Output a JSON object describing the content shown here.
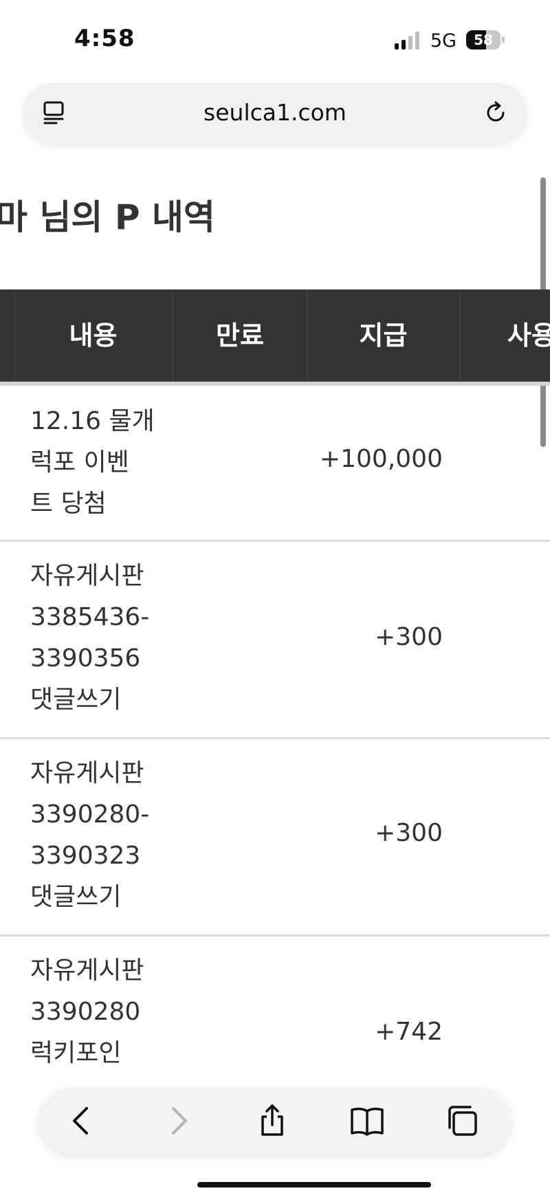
{
  "status_bar": {
    "time": "4:58",
    "network": "5G",
    "battery": "58",
    "battery_level": 0.58
  },
  "url_bar": {
    "url": "seulca1.com",
    "reader_icon": "reader-icon",
    "reload_icon": "reload-icon"
  },
  "page": {
    "title": "마 님의 P 내역"
  },
  "table": {
    "columns": [
      "내용",
      "만료",
      "지급",
      "사용"
    ],
    "rows": [
      {
        "content_lines": [
          "12.16 물개",
          "럭포 이벤",
          "트 당첨"
        ],
        "expiry": "",
        "paid": "+100,000",
        "used": ""
      },
      {
        "content_lines": [
          "자유게시판",
          "3385436-",
          "3390356",
          "댓글쓰기"
        ],
        "expiry": "",
        "paid": "+300",
        "used": ""
      },
      {
        "content_lines": [
          "자유게시판",
          "3390280-",
          "3390323",
          "댓글쓰기"
        ],
        "expiry": "",
        "paid": "+300",
        "used": ""
      },
      {
        "content_lines": [
          "자유게시판",
          "3390280",
          "럭키포인"
        ],
        "expiry": "",
        "paid": "+742",
        "used": ""
      }
    ]
  },
  "toolbar": {
    "back_icon": "back-icon",
    "forward_icon": "forward-icon",
    "share_icon": "share-icon",
    "bookmarks_icon": "bookmarks-icon",
    "tabs_icon": "tabs-icon"
  }
}
